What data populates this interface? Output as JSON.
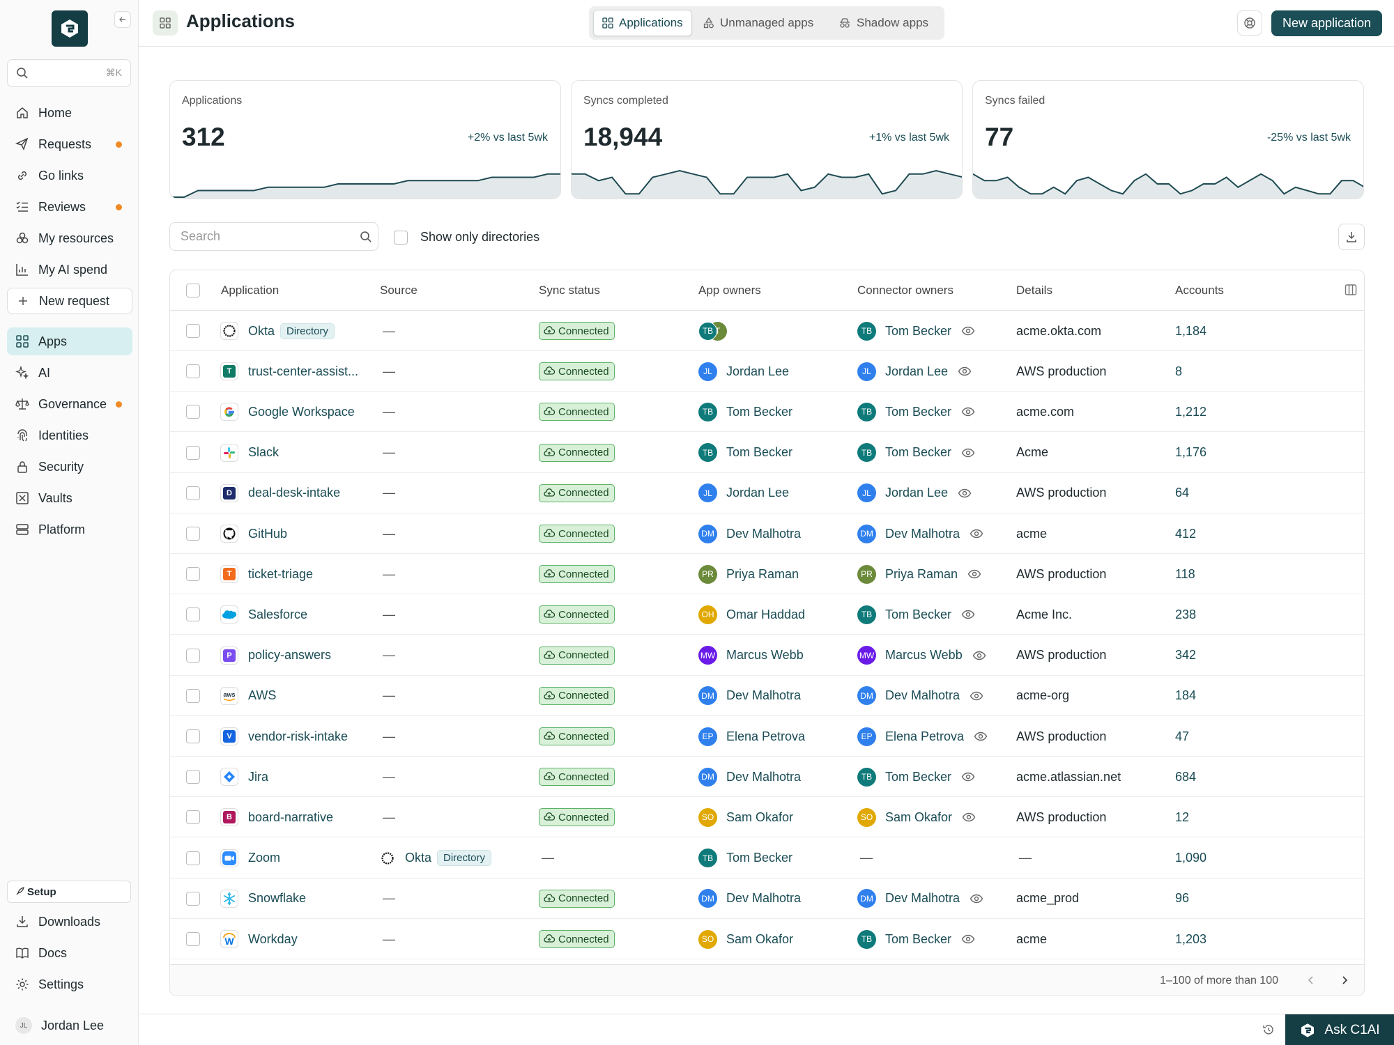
{
  "sidebar": {
    "search_shortcut": "⌘K",
    "nav": [
      {
        "label": "Home",
        "icon": "home-icon"
      },
      {
        "label": "Requests",
        "icon": "send-icon",
        "dot": true
      },
      {
        "label": "Go links",
        "icon": "link-icon"
      },
      {
        "label": "Reviews",
        "icon": "checklist-icon",
        "dot": true
      },
      {
        "label": "My resources",
        "icon": "resources-icon"
      },
      {
        "label": "My AI spend",
        "icon": "chart-icon"
      }
    ],
    "new_request": "New request",
    "nav2": [
      {
        "label": "Apps",
        "icon": "apps-grid-icon",
        "active": true
      },
      {
        "label": "AI",
        "icon": "sparkle-icon"
      },
      {
        "label": "Governance",
        "icon": "scale-icon",
        "dot": true
      },
      {
        "label": "Identities",
        "icon": "fingerprint-icon"
      },
      {
        "label": "Security",
        "icon": "lock-icon"
      },
      {
        "label": "Vaults",
        "icon": "vault-icon"
      },
      {
        "label": "Platform",
        "icon": "server-icon"
      }
    ],
    "setup": "Setup",
    "bottom_nav": [
      {
        "label": "Downloads",
        "icon": "download-icon"
      },
      {
        "label": "Docs",
        "icon": "book-icon"
      },
      {
        "label": "Settings",
        "icon": "gear-icon"
      }
    ],
    "user": {
      "initials": "JL",
      "name": "Jordan Lee"
    }
  },
  "header": {
    "title": "Applications",
    "tabs": [
      {
        "label": "Applications",
        "active": true
      },
      {
        "label": "Unmanaged apps"
      },
      {
        "label": "Shadow apps"
      }
    ],
    "new_button": "New application"
  },
  "cards": [
    {
      "label": "Applications",
      "value": "312",
      "delta": "+2% vs last 5wk",
      "spark": [
        0,
        0,
        2,
        2,
        2,
        2,
        2,
        3,
        3,
        3,
        3,
        3,
        4,
        4,
        4,
        4,
        4,
        5,
        5,
        5,
        5,
        5,
        5,
        6,
        6,
        6,
        6,
        7,
        7
      ]
    },
    {
      "label": "Syncs completed",
      "value": "18,944",
      "delta": "+1% vs last 5wk",
      "spark": [
        7,
        7,
        5,
        6,
        1,
        1,
        6,
        7,
        8,
        7,
        6,
        1,
        1,
        6,
        6,
        6,
        7,
        2,
        3,
        7,
        6,
        6,
        7,
        1,
        2,
        7,
        7,
        8,
        7,
        6
      ]
    },
    {
      "label": "Syncs failed",
      "value": "77",
      "delta": "-25% vs last 5wk",
      "spark": [
        7,
        5,
        5,
        6,
        3,
        1,
        1,
        3,
        1,
        5,
        6,
        4,
        2,
        1,
        5,
        7,
        4,
        4,
        1,
        2,
        4,
        4,
        6,
        3,
        5,
        7,
        5,
        1,
        3,
        2,
        1,
        1,
        5,
        5,
        3
      ]
    }
  ],
  "toolbar": {
    "search_placeholder": "Search",
    "directories_label": "Show only directories"
  },
  "table": {
    "columns": [
      "Application",
      "Source",
      "Sync status",
      "App owners",
      "Connector owners",
      "Details",
      "Accounts"
    ],
    "rows": [
      {
        "app": "Okta",
        "icon": "okta",
        "badge": "Directory",
        "source": "—",
        "status": "Connected",
        "owners": "stack",
        "owner_name": "",
        "owner_initials": "TB",
        "owner_color": "#0f7a7a",
        "conn": "Tom Becker",
        "conn_initials": "TB",
        "conn_color": "#0f7a7a",
        "details": "acme.okta.com",
        "accounts": "1,184"
      },
      {
        "app": "trust-center-assist...",
        "icon": "letter",
        "letter": "T",
        "letter_color": "#0f7b66",
        "badge": "",
        "source": "—",
        "status": "Connected",
        "owner_name": "Jordan Lee",
        "owner_initials": "JL",
        "owner_color": "#2f80ed",
        "conn": "Jordan Lee",
        "conn_initials": "JL",
        "conn_color": "#2f80ed",
        "details": "AWS production",
        "accounts": "8"
      },
      {
        "app": "Google Workspace",
        "icon": "google",
        "badge": "",
        "source": "—",
        "status": "Connected",
        "owner_name": "Tom Becker",
        "owner_initials": "TB",
        "owner_color": "#0f7a7a",
        "conn": "Tom Becker",
        "conn_initials": "TB",
        "conn_color": "#0f7a7a",
        "details": "acme.com",
        "accounts": "1,212"
      },
      {
        "app": "Slack",
        "icon": "slack",
        "badge": "",
        "source": "—",
        "status": "Connected",
        "owner_name": "Tom Becker",
        "owner_initials": "TB",
        "owner_color": "#0f7a7a",
        "conn": "Tom Becker",
        "conn_initials": "TB",
        "conn_color": "#0f7a7a",
        "details": "Acme",
        "accounts": "1,176"
      },
      {
        "app": "deal-desk-intake",
        "icon": "letter",
        "letter": "D",
        "letter_color": "#1e2c6b",
        "badge": "",
        "source": "—",
        "status": "Connected",
        "owner_name": "Jordan Lee",
        "owner_initials": "JL",
        "owner_color": "#2f80ed",
        "conn": "Jordan Lee",
        "conn_initials": "JL",
        "conn_color": "#2f80ed",
        "details": "AWS production",
        "accounts": "64"
      },
      {
        "app": "GitHub",
        "icon": "github",
        "badge": "",
        "source": "—",
        "status": "Connected",
        "owner_name": "Dev Malhotra",
        "owner_initials": "DM",
        "owner_color": "#2f80ed",
        "conn": "Dev Malhotra",
        "conn_initials": "DM",
        "conn_color": "#2f80ed",
        "details": "acme",
        "accounts": "412"
      },
      {
        "app": "ticket-triage",
        "icon": "letter",
        "letter": "T",
        "letter_color": "#f26b1d",
        "badge": "",
        "source": "—",
        "status": "Connected",
        "owner_name": "Priya Raman",
        "owner_initials": "PR",
        "owner_color": "#6b8a3a",
        "conn": "Priya Raman",
        "conn_initials": "PR",
        "conn_color": "#6b8a3a",
        "details": "AWS production",
        "accounts": "118"
      },
      {
        "app": "Salesforce",
        "icon": "salesforce",
        "badge": "",
        "source": "—",
        "status": "Connected",
        "owner_name": "Omar Haddad",
        "owner_initials": "OH",
        "owner_color": "#e0a800",
        "conn": "Tom Becker",
        "conn_initials": "TB",
        "conn_color": "#0f7a7a",
        "details": "Acme Inc.",
        "accounts": "238"
      },
      {
        "app": "policy-answers",
        "icon": "letter",
        "letter": "P",
        "letter_color": "#7b4cf0",
        "badge": "",
        "source": "—",
        "status": "Connected",
        "owner_name": "Marcus Webb",
        "owner_initials": "MW",
        "owner_color": "#6a1be8",
        "conn": "Marcus Webb",
        "conn_initials": "MW",
        "conn_color": "#6a1be8",
        "details": "AWS production",
        "accounts": "342"
      },
      {
        "app": "AWS",
        "icon": "aws",
        "badge": "",
        "source": "—",
        "status": "Connected",
        "owner_name": "Dev Malhotra",
        "owner_initials": "DM",
        "owner_color": "#2f80ed",
        "conn": "Dev Malhotra",
        "conn_initials": "DM",
        "conn_color": "#2f80ed",
        "details": "acme-org",
        "accounts": "184"
      },
      {
        "app": "vendor-risk-intake",
        "icon": "letter",
        "letter": "V",
        "letter_color": "#1565e0",
        "badge": "",
        "source": "—",
        "status": "Connected",
        "owner_name": "Elena Petrova",
        "owner_initials": "EP",
        "owner_color": "#2f80ed",
        "conn": "Elena Petrova",
        "conn_initials": "EP",
        "conn_color": "#2f80ed",
        "details": "AWS production",
        "accounts": "47"
      },
      {
        "app": "Jira",
        "icon": "jira",
        "badge": "",
        "source": "—",
        "status": "Connected",
        "owner_name": "Dev Malhotra",
        "owner_initials": "DM",
        "owner_color": "#2f80ed",
        "conn": "Tom Becker",
        "conn_initials": "TB",
        "conn_color": "#0f7a7a",
        "details": "acme.atlassian.net",
        "accounts": "684"
      },
      {
        "app": "board-narrative",
        "icon": "letter",
        "letter": "B",
        "letter_color": "#b0185e",
        "badge": "",
        "source": "—",
        "status": "Connected",
        "owner_name": "Sam Okafor",
        "owner_initials": "SO",
        "owner_color": "#e0a800",
        "conn": "Sam Okafor",
        "conn_initials": "SO",
        "conn_color": "#e0a800",
        "details": "AWS production",
        "accounts": "12"
      },
      {
        "app": "Zoom",
        "icon": "zoom",
        "badge": "",
        "source": "Okta",
        "source_badge": "Directory",
        "status": "",
        "owner_name": "Tom Becker",
        "owner_initials": "TB",
        "owner_color": "#0f7a7a",
        "conn": "",
        "details": "—",
        "accounts": "1,090"
      },
      {
        "app": "Snowflake",
        "icon": "snowflake",
        "badge": "",
        "source": "—",
        "status": "Connected",
        "owner_name": "Dev Malhotra",
        "owner_initials": "DM",
        "owner_color": "#2f80ed",
        "conn": "Dev Malhotra",
        "conn_initials": "DM",
        "conn_color": "#2f80ed",
        "details": "acme_prod",
        "accounts": "96"
      },
      {
        "app": "Workday",
        "icon": "workday",
        "badge": "",
        "source": "—",
        "status": "Connected",
        "owner_name": "Sam Okafor",
        "owner_initials": "SO",
        "owner_color": "#e0a800",
        "conn": "Tom Becker",
        "conn_initials": "TB",
        "conn_color": "#0f7a7a",
        "details": "acme",
        "accounts": "1,203"
      }
    ],
    "pagination": "1–100 of more than 100"
  },
  "bottom": {
    "ask_label": "Ask C1AI"
  },
  "colors": {
    "brand": "#143d44",
    "accent": "#1b4e56",
    "dot": "#f08a24",
    "status_bg": "#d8f0d8"
  }
}
